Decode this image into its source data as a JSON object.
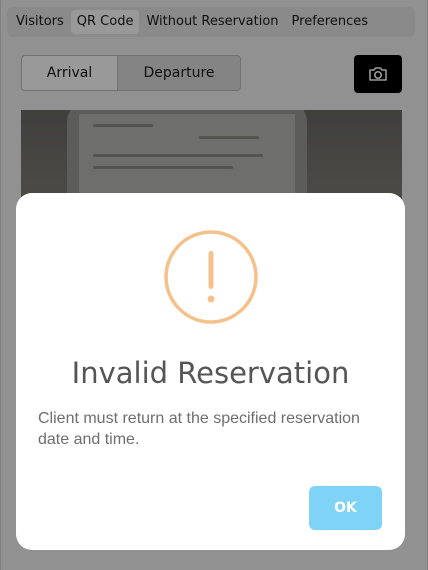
{
  "tabs": [
    {
      "label": "Visitors"
    },
    {
      "label": "QR Code"
    },
    {
      "label": "Without Reservation"
    },
    {
      "label": "Preferences"
    }
  ],
  "active_tab": "QR Code",
  "segment": {
    "arrival": "Arrival",
    "departure": "Departure",
    "selected": "Departure"
  },
  "camera_button": {
    "icon": "camera-icon"
  },
  "modal": {
    "icon": "exclamation-circle-icon",
    "title": "Invalid Reservation",
    "message": "Client must return at the specified reservation date and time.",
    "ok_label": "OK"
  },
  "colors": {
    "warning": "#f5c18a",
    "ok_button": "#7fd3f7",
    "title_text": "#555555"
  }
}
